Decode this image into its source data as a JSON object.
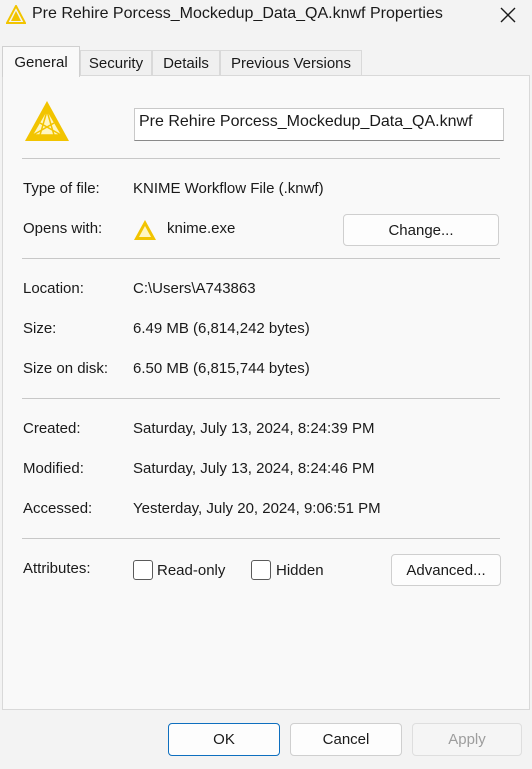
{
  "window": {
    "title": "Pre Rehire Porcess_Mockedup_Data_QA.knwf Properties",
    "close_icon": "close-icon"
  },
  "tabs": [
    {
      "label": "General",
      "active": true
    },
    {
      "label": "Security",
      "active": false
    },
    {
      "label": "Details",
      "active": false
    },
    {
      "label": "Previous Versions",
      "active": false
    }
  ],
  "general": {
    "file_icon": "knime-logo-icon",
    "file_name": "Pre Rehire Porcess_Mockedup_Data_QA.knwf",
    "type_label": "Type of file:",
    "type_value": "KNIME Workflow File (.knwf)",
    "opens_label": "Opens with:",
    "opens_value": "knime.exe",
    "change_button": "Change...",
    "location_label": "Location:",
    "location_value": "C:\\Users\\A743863",
    "size_label": "Size:",
    "size_value": "6.49 MB (6,814,242 bytes)",
    "size_disk_label": "Size on disk:",
    "size_disk_value": "6.50 MB (6,815,744 bytes)",
    "created_label": "Created:",
    "created_value": "Saturday, July 13, 2024, 8:24:39 PM",
    "modified_label": "Modified:",
    "modified_value": "Saturday, July 13, 2024, 8:24:46 PM",
    "accessed_label": "Accessed:",
    "accessed_value": "Yesterday, July 20, 2024, 9:06:51 PM",
    "attributes_label": "Attributes:",
    "readonly_label": "Read-only",
    "readonly_checked": false,
    "hidden_label": "Hidden",
    "hidden_checked": false,
    "advanced_button": "Advanced..."
  },
  "footer": {
    "ok": "OK",
    "cancel": "Cancel",
    "apply": "Apply"
  },
  "colors": {
    "knime_yellow": "#f2c400",
    "ok_border": "#0e6fbf"
  }
}
